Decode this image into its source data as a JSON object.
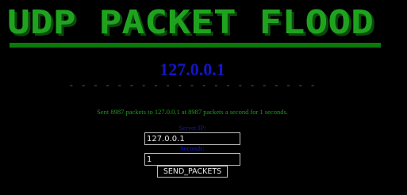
{
  "header": {
    "title": "UDP PACKET FLOOD",
    "title_color": "#1fa31f",
    "shadow_color": "#0c4a0c",
    "underline_color": "#0a7a0a"
  },
  "target": {
    "ip": "127.0.0.1",
    "color": "#1515c8",
    "separator": "- - - - - - - - - - - - - - - - - - - - -"
  },
  "status": {
    "message": "Sent 8987 packets to 127.0.0.1 at 8987 packets a second for 1 seconds.",
    "color": "#1e9a1e"
  },
  "form": {
    "server_ip_label": "Server IP:",
    "server_ip_value": "127.0.0.1",
    "seconds_label": "Seconds:",
    "seconds_value": "1",
    "submit_label": "SEND_PACKETS"
  }
}
